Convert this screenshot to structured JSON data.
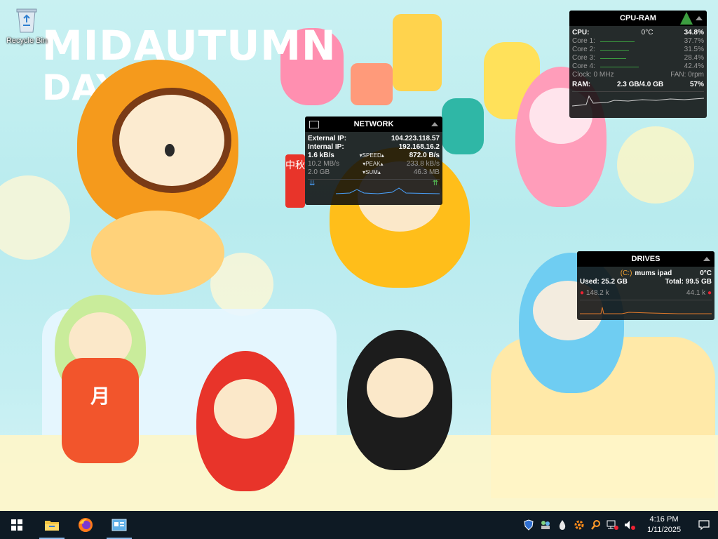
{
  "wallpaper": {
    "title_line1": "MIDAUTUMN",
    "title_line2": "DAY",
    "lantern_char": "月",
    "sign_chars": "中秋"
  },
  "desktop": {
    "recycle_bin_label": "Recycle Bin"
  },
  "cpu_ram": {
    "title": "CPU-RAM",
    "cpu_label": "CPU:",
    "cpu_temp": "0°C",
    "cpu_percent": "34.8%",
    "cores": [
      {
        "label": "Core 1:",
        "value": "37.7%",
        "level": 0.377
      },
      {
        "label": "Core 2:",
        "value": "31.5%",
        "level": 0.315
      },
      {
        "label": "Core 3:",
        "value": "28.4%",
        "level": 0.284
      },
      {
        "label": "Core 4:",
        "value": "42.4%",
        "level": 0.424
      }
    ],
    "clock_label": "Clock: 0 MHz",
    "fan_label": "FAN: 0rpm",
    "ram_label": "RAM:",
    "ram_usage": "2.3 GB/4.0 GB",
    "ram_percent": "57%"
  },
  "network": {
    "title": "NETWORK",
    "external_ip_label": "External IP:",
    "external_ip": "104.223.118.57",
    "internal_ip_label": "Internal IP:",
    "internal_ip": "192.168.16.2",
    "speed_down": "1.6 kB/s",
    "speed_label": "SPEED",
    "speed_up": "872.0 B/s",
    "peak_down": "10.2 MB/s",
    "peak_label": "PEAK",
    "peak_up": "233.8 kB/s",
    "sum_down": "2.0 GB",
    "sum_label": "SUM",
    "sum_up": "46.3 MB"
  },
  "drives": {
    "title": "DRIVES",
    "drive_letter": "(C:)",
    "drive_name": "mums ipad",
    "drive_temp": "0°C",
    "used": "Used: 25.2 GB",
    "total": "Total: 99.5 GB",
    "read_rate": "148.2 k",
    "write_rate": "44.1 k"
  },
  "taskbar": {
    "time": "4:16 PM",
    "date": "1/11/2025"
  },
  "colors": {
    "accent_green": "#3c9e40",
    "taskbar_bg": "#0e1a24",
    "gadget_bg": "#0a0a0a"
  },
  "icons": {
    "start": "windows-start-icon",
    "explorer": "file-explorer-icon",
    "firefox": "firefox-icon",
    "control": "control-panel-icon"
  }
}
